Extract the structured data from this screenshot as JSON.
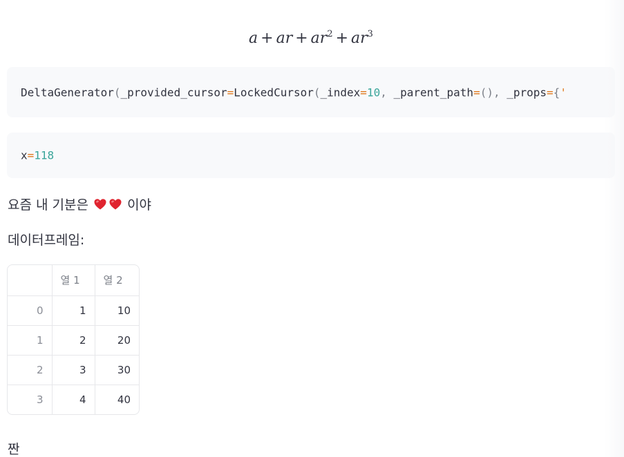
{
  "latex": {
    "terms": [
      "a",
      "ar",
      "ar",
      "ar"
    ],
    "operator": "+",
    "exponents": [
      "2",
      "3"
    ]
  },
  "code_block_1": {
    "tokens": [
      {
        "text": "DeltaGenerator",
        "kind": "plain"
      },
      {
        "text": "(",
        "kind": "punc"
      },
      {
        "text": "_provided_cursor",
        "kind": "plain"
      },
      {
        "text": "=",
        "kind": "op"
      },
      {
        "text": "LockedCursor",
        "kind": "plain"
      },
      {
        "text": "(",
        "kind": "punc"
      },
      {
        "text": "_index",
        "kind": "plain"
      },
      {
        "text": "=",
        "kind": "op"
      },
      {
        "text": "10",
        "kind": "num"
      },
      {
        "text": ", ",
        "kind": "punc"
      },
      {
        "text": "_parent_path",
        "kind": "plain"
      },
      {
        "text": "=",
        "kind": "op"
      },
      {
        "text": "(), ",
        "kind": "punc"
      },
      {
        "text": "_props",
        "kind": "plain"
      },
      {
        "text": "=",
        "kind": "op"
      },
      {
        "text": "{",
        "kind": "punc"
      },
      {
        "text": "'",
        "kind": "str"
      }
    ]
  },
  "code_block_2": {
    "tokens": [
      {
        "text": "x",
        "kind": "plain"
      },
      {
        "text": "=",
        "kind": "op"
      },
      {
        "text": "118",
        "kind": "num"
      }
    ]
  },
  "mood_text": {
    "prefix": "요즘 내 기분은",
    "suffix": "이야",
    "emoji": [
      "heart-emoji",
      "heart-emoji"
    ]
  },
  "dataframe_label": "데이터프레임:",
  "dataframe": {
    "columns": [
      "",
      "열 1",
      "열 2"
    ],
    "rows": [
      {
        "index": "0",
        "a": "1",
        "b": "10"
      },
      {
        "index": "1",
        "a": "2",
        "b": "20"
      },
      {
        "index": "2",
        "a": "3",
        "b": "30"
      },
      {
        "index": "3",
        "a": "4",
        "b": "40"
      }
    ]
  },
  "bottom_text": "짠",
  "colors": {
    "text": "#31333f",
    "code_bg": "#f8f9fb",
    "operator": "#e07a1f",
    "number": "#3aa59a",
    "heart": "#e0242f"
  }
}
